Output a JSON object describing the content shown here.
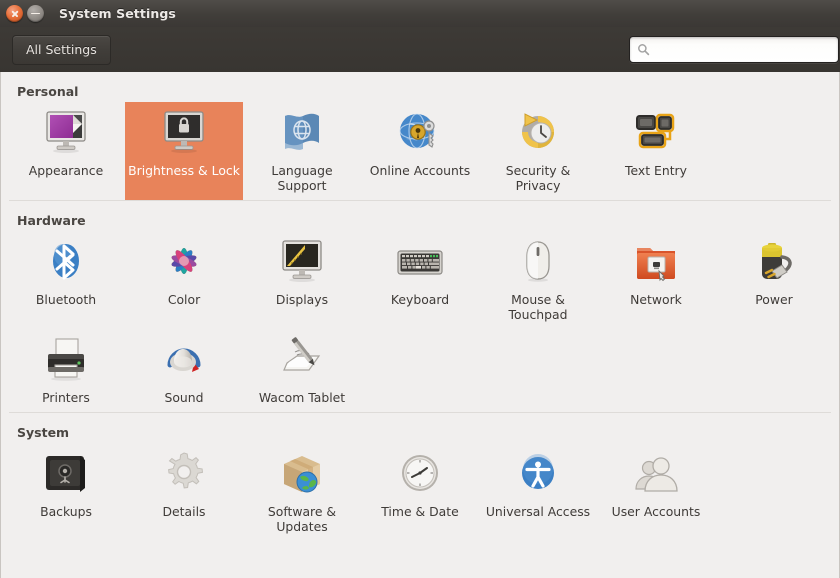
{
  "window": {
    "title": "System Settings",
    "close_icon": "close-icon",
    "minimize_icon": "minimize-icon"
  },
  "toolbar": {
    "all_settings_label": "All Settings",
    "search_icon": "search-icon",
    "search_value": "",
    "search_placeholder": ""
  },
  "theme": {
    "selection_color": "#e8835a",
    "titlebar_color": "#3d3a36",
    "content_bg": "#f1efee",
    "label_color": "#3f3b38"
  },
  "sections": [
    {
      "title": "Personal",
      "items": [
        {
          "label": "Appearance",
          "icon": "appearance-icon",
          "selected": false
        },
        {
          "label": "Brightness & Lock",
          "icon": "brightness-lock-icon",
          "selected": true
        },
        {
          "label": "Language Support",
          "icon": "language-support-icon",
          "selected": false
        },
        {
          "label": "Online Accounts",
          "icon": "online-accounts-icon",
          "selected": false
        },
        {
          "label": "Security & Privacy",
          "icon": "security-privacy-icon",
          "selected": false
        },
        {
          "label": "Text Entry",
          "icon": "text-entry-icon",
          "selected": false
        }
      ]
    },
    {
      "title": "Hardware",
      "items": [
        {
          "label": "Bluetooth",
          "icon": "bluetooth-icon",
          "selected": false
        },
        {
          "label": "Color",
          "icon": "color-icon",
          "selected": false
        },
        {
          "label": "Displays",
          "icon": "displays-icon",
          "selected": false
        },
        {
          "label": "Keyboard",
          "icon": "keyboard-icon",
          "selected": false
        },
        {
          "label": "Mouse & Touchpad",
          "icon": "mouse-touchpad-icon",
          "selected": false
        },
        {
          "label": "Network",
          "icon": "network-icon",
          "selected": false
        },
        {
          "label": "Power",
          "icon": "power-icon",
          "selected": false
        },
        {
          "label": "Printers",
          "icon": "printers-icon",
          "selected": false
        },
        {
          "label": "Sound",
          "icon": "sound-icon",
          "selected": false
        },
        {
          "label": "Wacom Tablet",
          "icon": "wacom-tablet-icon",
          "selected": false
        }
      ]
    },
    {
      "title": "System",
      "items": [
        {
          "label": "Backups",
          "icon": "backups-icon",
          "selected": false
        },
        {
          "label": "Details",
          "icon": "details-icon",
          "selected": false
        },
        {
          "label": "Software & Updates",
          "icon": "software-updates-icon",
          "selected": false
        },
        {
          "label": "Time & Date",
          "icon": "time-date-icon",
          "selected": false
        },
        {
          "label": "Universal Access",
          "icon": "universal-access-icon",
          "selected": false
        },
        {
          "label": "User Accounts",
          "icon": "user-accounts-icon",
          "selected": false
        }
      ]
    }
  ]
}
